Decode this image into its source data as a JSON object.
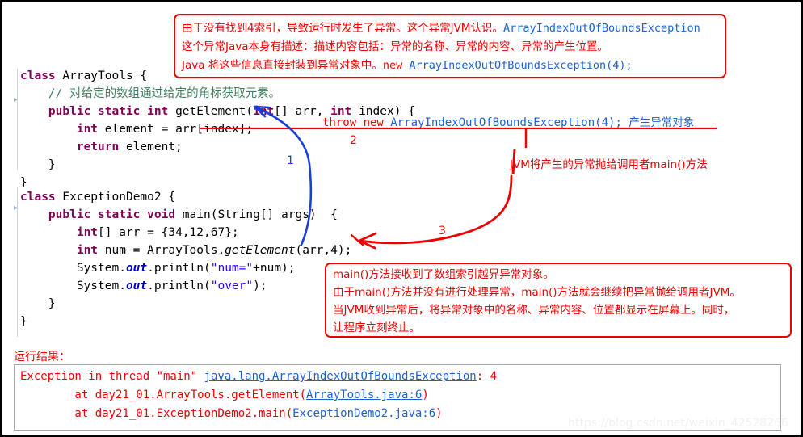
{
  "code_top": {
    "lines": [
      [
        {
          "t": "class ",
          "c": "kw"
        },
        {
          "t": "ArrayTools {",
          "c": "plain"
        }
      ],
      [
        {
          "t": "    // 对给定的数组通过给定的角标获取元素。",
          "c": "cmt"
        }
      ],
      [
        {
          "t": "    ",
          "c": "plain"
        },
        {
          "t": "public static int ",
          "c": "kw"
        },
        {
          "t": "getElement(",
          "c": "plain"
        },
        {
          "t": "int",
          "c": "kw"
        },
        {
          "t": "[] arr, ",
          "c": "plain"
        },
        {
          "t": "int ",
          "c": "kw"
        },
        {
          "t": "index) {",
          "c": "plain"
        }
      ],
      [
        {
          "t": "        ",
          "c": "plain"
        },
        {
          "t": "int ",
          "c": "kw"
        },
        {
          "t": "element = arr[index];",
          "c": "plain"
        }
      ],
      [
        {
          "t": "        ",
          "c": "plain"
        },
        {
          "t": "return ",
          "c": "kw"
        },
        {
          "t": "element;",
          "c": "plain"
        }
      ],
      [
        {
          "t": "    }",
          "c": "plain"
        }
      ],
      [
        {
          "t": "}",
          "c": "plain"
        }
      ]
    ]
  },
  "code_bottom": {
    "lines": [
      [
        {
          "t": "class ",
          "c": "kw"
        },
        {
          "t": "ExceptionDemo2 {",
          "c": "plain"
        }
      ],
      [
        {
          "t": "    ",
          "c": "plain"
        },
        {
          "t": "public static void ",
          "c": "kw"
        },
        {
          "t": "main(String[] args)  {",
          "c": "plain"
        }
      ],
      [
        {
          "t": "        ",
          "c": "plain"
        },
        {
          "t": "int",
          "c": "kw"
        },
        {
          "t": "[] arr = {34,12,67};",
          "c": "plain"
        }
      ],
      [
        {
          "t": "        ",
          "c": "plain"
        },
        {
          "t": "int ",
          "c": "kw"
        },
        {
          "t": "num = ArrayTools.",
          "c": "plain"
        },
        {
          "t": "getElement",
          "c": "mth"
        },
        {
          "t": "(arr,4);",
          "c": "plain"
        }
      ],
      [
        {
          "t": "        System.",
          "c": "plain"
        },
        {
          "t": "out",
          "c": "fld"
        },
        {
          "t": ".println(",
          "c": "plain"
        },
        {
          "t": "\"num=\"",
          "c": "str"
        },
        {
          "t": "+num);",
          "c": "plain"
        }
      ],
      [
        {
          "t": "        System.",
          "c": "plain"
        },
        {
          "t": "out",
          "c": "fld"
        },
        {
          "t": ".println(",
          "c": "plain"
        },
        {
          "t": "\"over\"",
          "c": "str"
        },
        {
          "t": ");",
          "c": "plain"
        }
      ],
      [
        {
          "t": "    }",
          "c": "plain"
        }
      ],
      [
        {
          "t": "}",
          "c": "plain"
        }
      ]
    ]
  },
  "top_annotation": {
    "line1_red_a": "由于没有找到4索引，导致运行时发生了异常。这个异常JVM认识。",
    "line1_blue": "ArrayIndexOutOfBoundsException",
    "line2": "这个异常Java本身有描述：描述内容包括：异常的名称、异常的内容、异常的产生位置。",
    "line3_red_a": "Java 将这些信息直接封装到异常对象中。",
    "line3_red_b": "new ",
    "line3_blue": "ArrayIndexOutOfBoundsException(4);"
  },
  "throw_annotation": {
    "red_part": "throw new ",
    "blue_class": "ArrayIndexOutOfBoundsException(4); ",
    "blue_cn": "产生异常对象"
  },
  "jvm_annotation": {
    "text": "JVM将产生的异常抛给调用者main()方法"
  },
  "bottom_annotation": {
    "line1": "main()方法接收到了数组索引越界异常对象。",
    "line2": "由于main()方法并没有进行处理异常，main()方法就会继续把异常抛给调用者JVM。",
    "line3": "当JVM收到异常后，将异常对象中的名称、异常内容、位置都显示在屏幕上。同时，",
    "line4": "让程序立刻终止。"
  },
  "step_numbers": {
    "one": "1",
    "two": "2",
    "three": "3"
  },
  "result": {
    "label": "运行结果：",
    "line1_a": "Exception in thread \"main\" ",
    "line1_link": "java.lang.ArrayIndexOutOfBoundsException",
    "line1_b": ": 4",
    "line2_a": "        at day21_01.ArrayTools.getElement(",
    "line2_link": "ArrayTools.java:6",
    "line2_b": ")",
    "line3_a": "        at day21_01.ExceptionDemo2.main(",
    "line3_link": "ExceptionDemo2.java:6",
    "line3_b": ")"
  },
  "watermark": {
    "text": "https://blog.csdn.net/weixin_42528266"
  },
  "colors": {
    "annotation_red": "#ee0000",
    "link_blue": "#1a62d6",
    "keyword_purple": "#7f0055",
    "comment_green": "#3f7f5f",
    "string_blue": "#2a00ff",
    "arrow_blue": "#1a3fd6"
  }
}
